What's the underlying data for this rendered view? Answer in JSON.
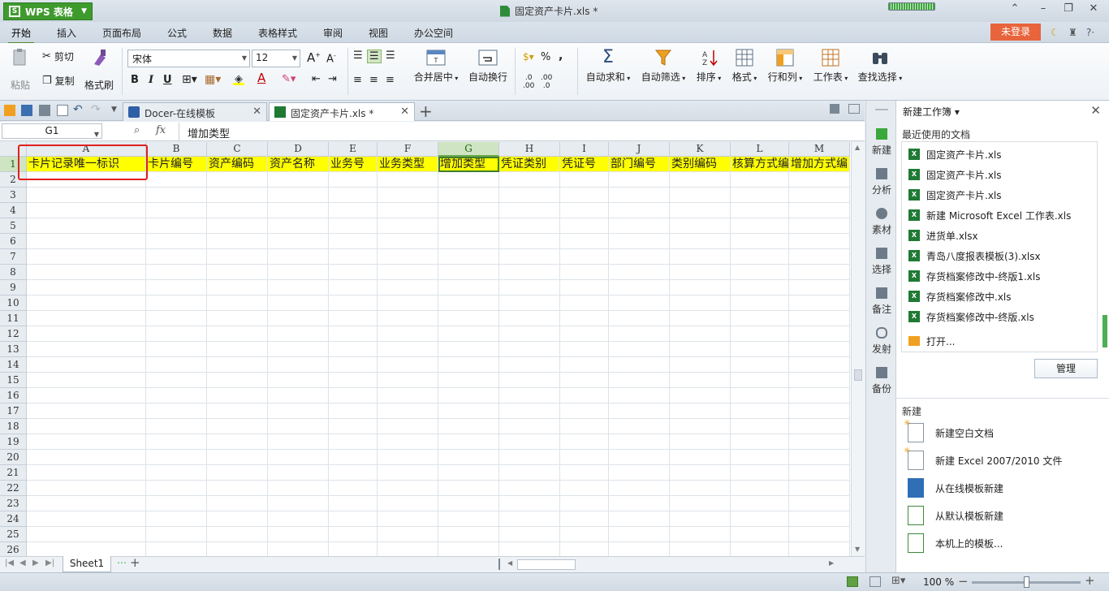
{
  "titlebar": {
    "app_name": "WPS 表格",
    "document_title": "固定资产卡片.xls *"
  },
  "menu": {
    "items": [
      "开始",
      "插入",
      "页面布局",
      "公式",
      "数据",
      "表格样式",
      "审阅",
      "视图",
      "办公空间"
    ],
    "active": "开始",
    "login_label": "未登录"
  },
  "ribbon": {
    "paste": "粘贴",
    "cut": "剪切",
    "copy": "复制",
    "format_painter": "格式刷",
    "font_name": "宋体",
    "font_size": "12",
    "bold": "B",
    "italic": "I",
    "underline": "U",
    "merge_center": "合并居中",
    "wrap_text": "自动换行",
    "autosum": "自动求和",
    "autofilter": "自动筛选",
    "sort": "排序",
    "format": "格式",
    "row_col": "行和列",
    "worksheet": "工作表",
    "find_select": "查找选择",
    "percent": "%",
    "comma": ","
  },
  "tabs": {
    "docer": "Docer-在线模板",
    "workbook": "固定资产卡片.xls *"
  },
  "formula_bar": {
    "cell_ref": "G1",
    "fx": "fx",
    "content": "增加类型"
  },
  "sheet": {
    "columns": [
      "A",
      "B",
      "C",
      "D",
      "E",
      "F",
      "G",
      "H",
      "I",
      "J",
      "K",
      "L",
      "M"
    ],
    "selected_column": "G",
    "rows": [
      "1",
      "2",
      "3",
      "4",
      "5",
      "6",
      "7",
      "8",
      "9",
      "10",
      "11",
      "12",
      "13",
      "14",
      "15",
      "16",
      "17",
      "18",
      "19",
      "20",
      "21",
      "22",
      "23",
      "24",
      "25",
      "26"
    ],
    "header_row": [
      "卡片记录唯一标识",
      "卡片编号",
      "资产编码",
      "资产名称",
      "业务号",
      "业务类型",
      "增加类型",
      "凭证类别",
      "凭证号",
      "部门编号",
      "类别编码",
      "核算方式编",
      "增加方式编"
    ],
    "highlight_color": "#ffff00",
    "active_cell": "G1",
    "sheet_tab": "Sheet1"
  },
  "side_strip": {
    "items": [
      "新建",
      "分析",
      "素材",
      "选择",
      "备注",
      "发射",
      "备份"
    ]
  },
  "task_pane": {
    "title": "新建工作簿",
    "recent_label": "最近使用的文档",
    "recent_docs": [
      "固定资产卡片.xls",
      "固定资产卡片.xls",
      "固定资产卡片.xls",
      "新建 Microsoft Excel 工作表.xls",
      "进货单.xlsx",
      "青岛八度报表模板(3).xlsx",
      "存货档案修改中-终版1.xls",
      "存货档案修改中.xls",
      "存货档案修改中-终版.xls"
    ],
    "open_label": "打开...",
    "manage_label": "管理",
    "new_label": "新建",
    "new_items": [
      "新建空白文档",
      "新建 Excel 2007/2010 文件",
      "从在线模板新建",
      "从默认模板新建",
      "本机上的模板..."
    ]
  },
  "status": {
    "zoom": "100 %"
  }
}
